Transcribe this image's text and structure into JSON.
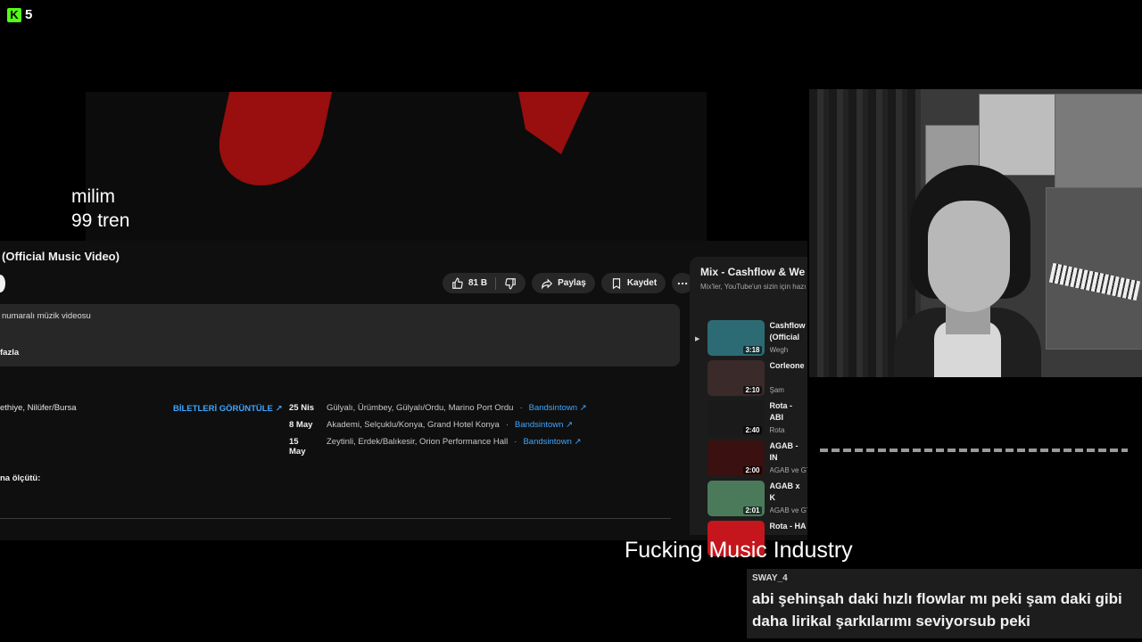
{
  "overlay": {
    "badge_count": "5",
    "video_text_line1": "milim",
    "video_text_line2": "99 tren",
    "now_playing": "Fucking Music Industry"
  },
  "youtube": {
    "title": "(Official Music Video)",
    "actions": {
      "like_count": "81 B",
      "share_label": "Paylaş",
      "save_label": "Kaydet"
    },
    "description_line1": "numaralı müzik videosu",
    "description_more": "fazla",
    "location": "ethiye, Nilüfer/Bursa",
    "tickets_label": "BİLETLERİ GÖRÜNTÜLE",
    "events": [
      {
        "date": "25 Nis",
        "venue": "Gülyalı, Ürümbey, Gülyalı/Ordu, Marino Port Ordu",
        "source": "Bandsintown"
      },
      {
        "date": "8 May",
        "venue": "Akademi, Selçuklu/Konya, Grand Hotel Konya",
        "source": "Bandsintown"
      },
      {
        "date": "15 May",
        "venue": "Zeytinli, Erdek/Balıkesir, Orion Performance Hall",
        "source": "Bandsintown"
      }
    ],
    "criteria_label": "na ölçütü:"
  },
  "mix": {
    "title": "Mix - Cashflow & We",
    "subtitle": "Mix'ler, YouTube'un sizin için hazı",
    "items": [
      {
        "title": "Cashflow\n(Official M",
        "artist": "Wegh",
        "duration": "3:18",
        "thumb_color": "#2c6b73",
        "playing": true
      },
      {
        "title": "Corleone",
        "artist": "Şam",
        "duration": "2:10",
        "thumb_color": "#3a2a2a",
        "playing": false
      },
      {
        "title": "Rota - ABI",
        "artist": "Rota",
        "duration": "2:40",
        "thumb_color": "#1a1a1a",
        "playing": false
      },
      {
        "title": "AGAB - IN\nmusic vid",
        "artist": "AGAB ve GT",
        "duration": "2:00",
        "thumb_color": "#3a1010",
        "playing": false
      },
      {
        "title": "AGAB x K\n(official m",
        "artist": "AGAB ve GT",
        "duration": "2:01",
        "thumb_color": "#4a7a5a",
        "playing": false
      },
      {
        "title": "Rota - HA",
        "artist": "",
        "duration": "",
        "thumb_color": "#c4161c",
        "playing": false
      }
    ]
  },
  "chat": {
    "username": "SWAY_4",
    "message": "abi şehinşah daki hızlı flowlar mı peki şam daki gibi daha lirikal şarkılarımı seviyorsub peki"
  },
  "colors": {
    "kick_green": "#53fc18",
    "link_blue": "#3ea6ff",
    "yt_bg": "#0f0f0f"
  }
}
